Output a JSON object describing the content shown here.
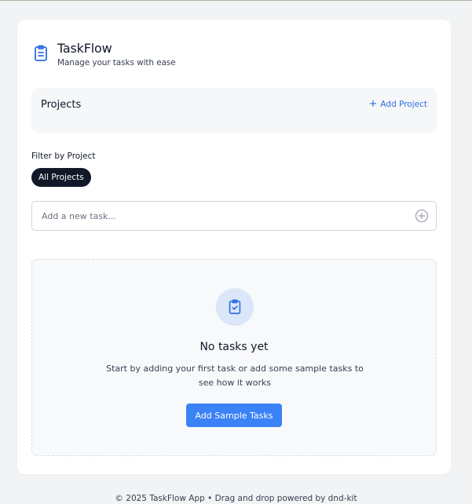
{
  "app": {
    "title": "TaskFlow",
    "subtitle": "Manage your tasks with ease",
    "logo_icon": "clipboard-icon"
  },
  "projects": {
    "title": "Projects",
    "add_label": "Add Project"
  },
  "filter": {
    "label": "Filter by Project",
    "options": [
      "All Projects"
    ],
    "selected": "All Projects"
  },
  "task_input": {
    "placeholder": "Add a new task...",
    "value": "",
    "add_icon": "plus-circle-icon"
  },
  "empty_state": {
    "icon": "clipboard-check-icon",
    "title": "No tasks yet",
    "description": "Start by adding your first task or add some sample tasks to see how it works",
    "button_label": "Add Sample Tasks"
  },
  "footer": {
    "text": "© 2025 TaskFlow App • Drag and drop powered by dnd-kit"
  },
  "colors": {
    "primary": "#3b82f6",
    "link": "#2f6fe0",
    "pill_bg": "#111827",
    "page_bg": "#f1f3f5"
  }
}
